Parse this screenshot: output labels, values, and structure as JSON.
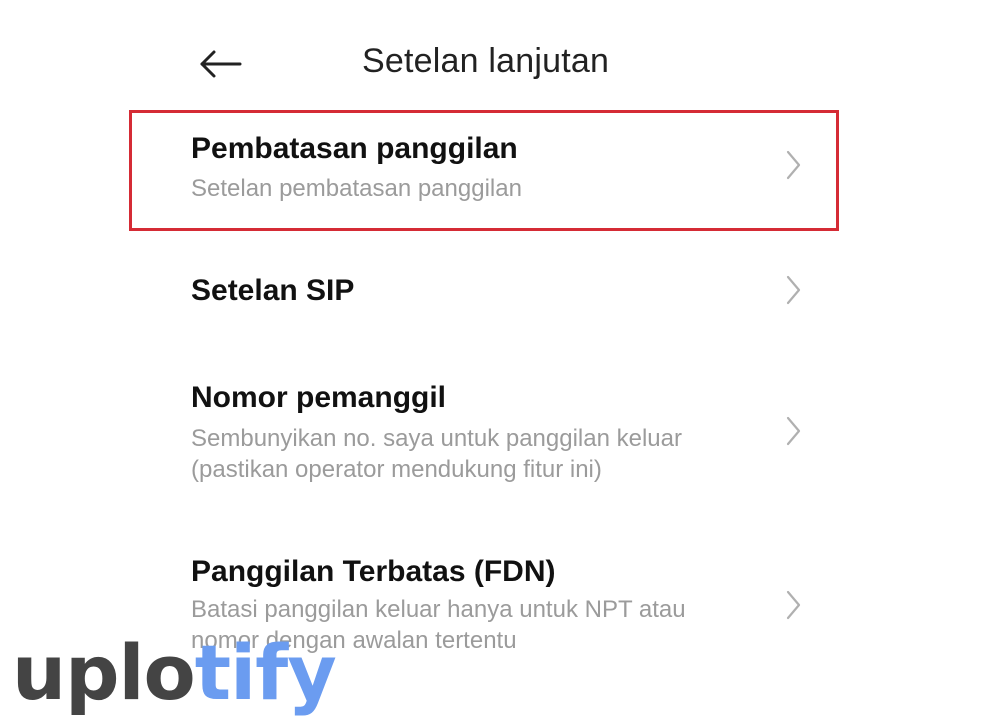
{
  "header": {
    "back_icon": "arrow-left-icon",
    "title": "Setelan lanjutan"
  },
  "items": [
    {
      "title": "Pembatasan panggilan",
      "subtitle": "Setelan pembatasan panggilan",
      "highlighted": true
    },
    {
      "title": "Setelan SIP",
      "subtitle": ""
    },
    {
      "title": "Nomor pemanggil",
      "subtitle": "Sembunyikan no. saya untuk panggilan keluar (pastikan operator mendukung fitur ini)"
    },
    {
      "title": "Panggilan Terbatas (FDN)",
      "subtitle": "Batasi panggilan keluar hanya untuk NPT atau nomor dengan awalan tertentu"
    }
  ],
  "chevron_icon": "chevron-right-icon",
  "watermark": {
    "part1": "uplo",
    "part2": "tify"
  },
  "colors": {
    "highlight_border": "#d52b35",
    "title_text": "#111111",
    "subtitle_text": "#9b9b9b",
    "watermark_dark": "#444444",
    "watermark_accent": "#6b9cf0"
  }
}
